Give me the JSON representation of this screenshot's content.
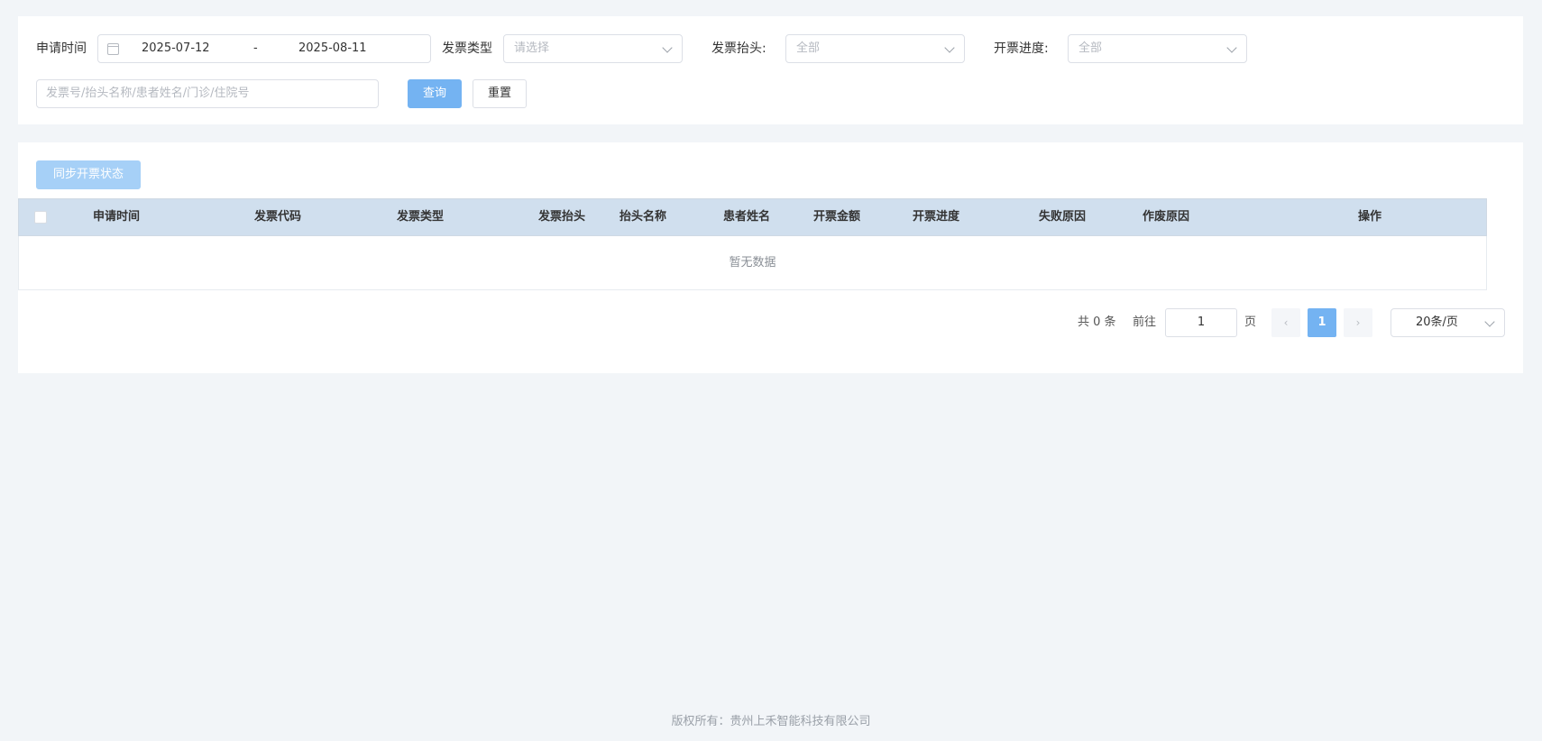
{
  "filters": {
    "apply_time_label": "申请时间",
    "date_start": "2025-07-12",
    "date_separator": "-",
    "date_end": "2025-08-11",
    "invoice_type_label": "发票类型",
    "invoice_type_placeholder": "请选择",
    "invoice_title_label": "发票抬头:",
    "invoice_title_value": "全部",
    "progress_label": "开票进度:",
    "progress_value": "全部",
    "search_placeholder": "发票号/抬头名称/患者姓名/门诊/住院号",
    "query_button": "查询",
    "reset_button": "重置"
  },
  "toolbar": {
    "sync_button": "同步开票状态"
  },
  "table": {
    "columns": [
      "申请时间",
      "发票代码",
      "发票类型",
      "发票抬头",
      "抬头名称",
      "患者姓名",
      "开票金额",
      "开票进度",
      "失败原因",
      "作废原因",
      "操作"
    ],
    "empty_text": "暂无数据"
  },
  "pagination": {
    "total_text": "共 0 条",
    "goto_label": "前往",
    "goto_value": "1",
    "page_suffix": "页",
    "current_page": "1",
    "page_size": "20条/页"
  },
  "footer": {
    "copyright": "版权所有：贵州上禾智能科技有限公司"
  },
  "colors": {
    "primary": "#74b3f2",
    "header_bg": "#d0dfee",
    "page_bg": "#f2f5f8"
  }
}
